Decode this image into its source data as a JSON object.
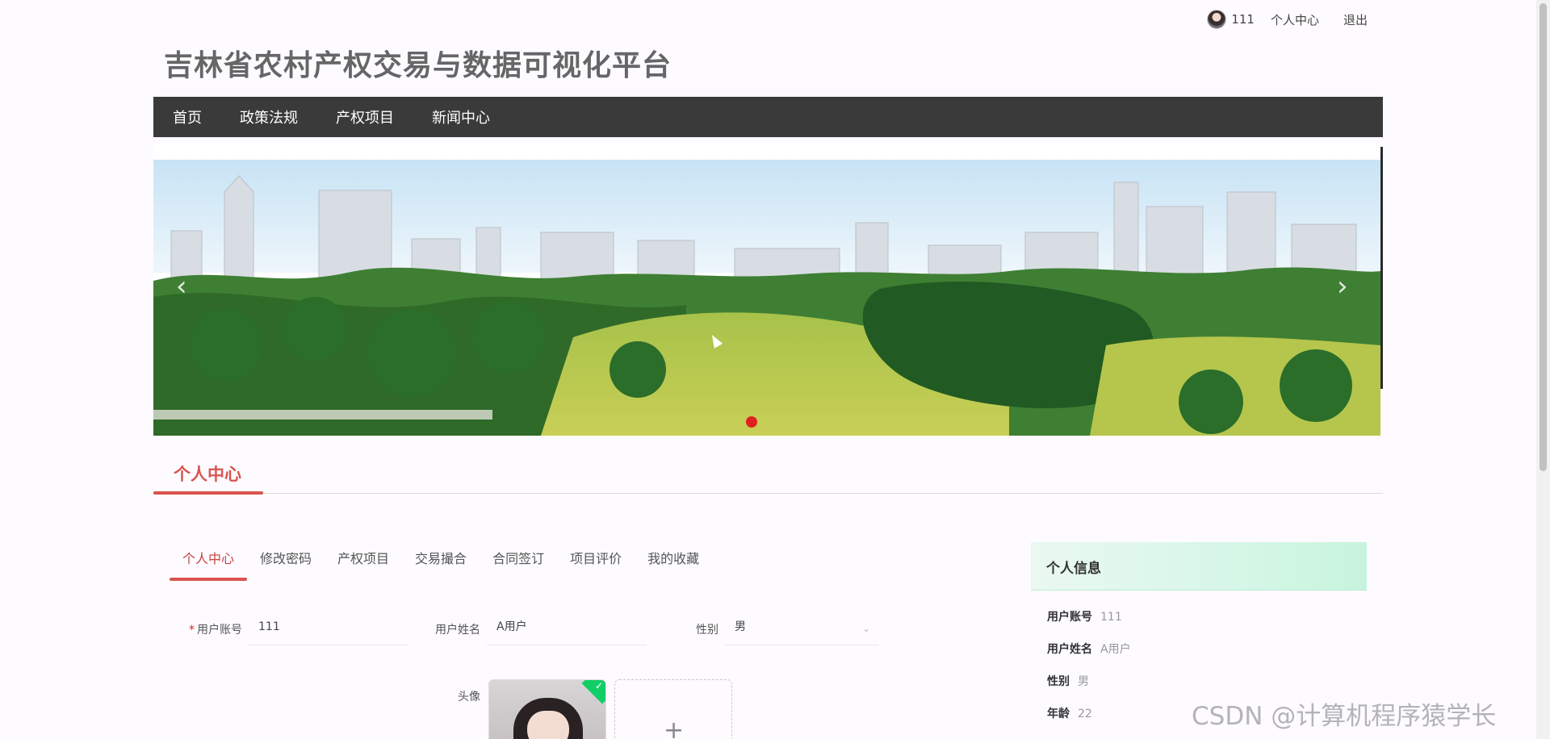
{
  "topbar": {
    "username": "111",
    "profile_link": "个人中心",
    "logout_link": "退出"
  },
  "site": {
    "title": "吉林省农村产权交易与数据可视化平台"
  },
  "nav": {
    "items": [
      {
        "label": "首页"
      },
      {
        "label": "政策法规"
      },
      {
        "label": "产权项目"
      },
      {
        "label": "新闻中心"
      }
    ]
  },
  "banner": {
    "prev": "‹",
    "next": "›",
    "active_slide": 1
  },
  "section": {
    "title": "个人中心"
  },
  "tabs": [
    {
      "label": "个人中心",
      "active": true
    },
    {
      "label": "修改密码"
    },
    {
      "label": "产权项目"
    },
    {
      "label": "交易撮合"
    },
    {
      "label": "合同签订"
    },
    {
      "label": "项目评价"
    },
    {
      "label": "我的收藏"
    }
  ],
  "form": {
    "account_label": "用户账号",
    "account_value": "111",
    "name_label": "用户姓名",
    "name_value": "A用户",
    "gender_label": "性别",
    "gender_value": "男",
    "avatar_label": "头像",
    "add_symbol": "+"
  },
  "side": {
    "title": "个人信息",
    "rows": [
      {
        "k": "用户账号",
        "v": "111"
      },
      {
        "k": "用户姓名",
        "v": "A用户"
      },
      {
        "k": "性别",
        "v": "男"
      },
      {
        "k": "年龄",
        "v": "22"
      }
    ]
  },
  "watermark": "CSDN @计算机程序猿学长",
  "colors": {
    "accent": "#d9534f",
    "nav_bg": "#393a39",
    "success": "#13ce66"
  }
}
